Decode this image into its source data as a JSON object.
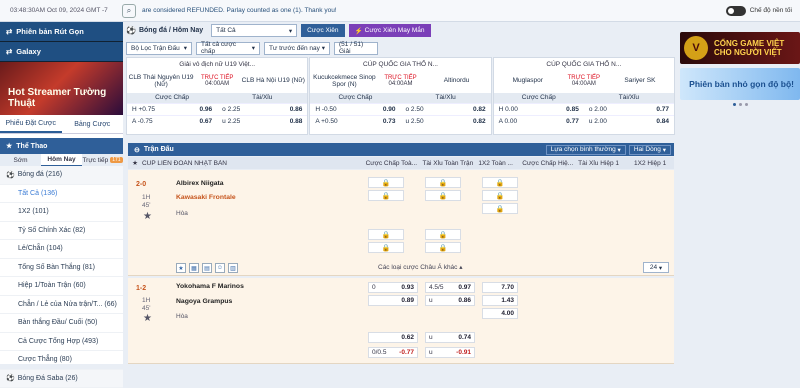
{
  "topbar": {
    "time": "03:48:30AM Oct 09, 2024 GMT -7",
    "notice": "are considered REFUNDED. Parlay counted as one (1). Thank you!",
    "toggle_label": "Chế độ nền tối"
  },
  "sidebar": {
    "promo1": "Phiên bản Rút Gọn",
    "promo2": "Galaxy",
    "banner": "Hot Streamer Tường Thuật",
    "tab_odds": "Phiếu Đặt Cược",
    "tab_table": "Bảng Cược",
    "sport_title": "Thể Thao",
    "subtabs": [
      "Sớm",
      "Hôm Nay",
      "Trực tiếp"
    ],
    "live_badge": "171",
    "items": [
      {
        "label": "Bóng đá",
        "count": "(216)"
      },
      {
        "label": "Tất Cả",
        "count": "(136)"
      },
      {
        "label": "1X2",
        "count": "(101)"
      },
      {
        "label": "Tỷ Số Chính Xác",
        "count": "(82)"
      },
      {
        "label": "Lẻ/Chẵn",
        "count": "(104)"
      },
      {
        "label": "Tổng Số Bàn Thắng",
        "count": "(81)"
      },
      {
        "label": "Hiệp 1/Toàn Trận",
        "count": "(60)"
      },
      {
        "label": "Chẵn / Lẻ của Nửa trận/T...",
        "count": "(66)"
      },
      {
        "label": "Bàn thắng Đầu/ Cuối",
        "count": "(50)"
      },
      {
        "label": "Cả Cược Tổng Hợp",
        "count": "(493)"
      },
      {
        "label": "Cược Thẳng",
        "count": "(80)"
      },
      {
        "label": "Bóng Đá Saba",
        "count": "(26)"
      }
    ]
  },
  "toolbar": {
    "breadcrumb": "Bóng đá / Hôm Nay",
    "filter_all": "Tất Cả",
    "btn_parlay": "Cược Xiên",
    "btn_lucky": "Cược Xiên May Mắn",
    "filter_league": "Bộ Lọc Trận Đấu",
    "filter_markets": "Tất cả cược chấp",
    "sort": "Tư trước đến nay",
    "count": "(51 / 51) Giải"
  },
  "cards": [
    {
      "league": "Giải vô địch nữ U19 Việt...",
      "home": "CLB Thái Nguyên U19 (Nữ)",
      "away": "CLB Hà Nội U19 (Nữ)",
      "live": "TRỰC TIẾP",
      "time": "04:00AM",
      "m1": "Cược Chấp",
      "m2": "Tài/Xỉu",
      "rows": [
        [
          "H +0.75",
          "0.96",
          "o 2.25",
          "0.86"
        ],
        [
          "A -0.75",
          "0.67",
          "u 2.25",
          "0.88"
        ]
      ]
    },
    {
      "league": "CÚP QUỐC GIA THỔ N...",
      "home": "Kucukcekmece Sinop Spor (N)",
      "away": "Altinordu",
      "live": "TRỰC TIẾP",
      "time": "04:00AM",
      "m1": "Cược Chấp",
      "m2": "Tài/Xỉu",
      "rows": [
        [
          "H -0.50",
          "0.90",
          "o 2.50",
          "0.82"
        ],
        [
          "A +0.50",
          "0.73",
          "u 2.50",
          "0.82"
        ]
      ]
    },
    {
      "league": "CÚP QUỐC GIA THỔ N...",
      "home": "Muglaspor",
      "away": "Sariyer SK",
      "live": "TRỰC TIẾP",
      "time": "04:00AM",
      "m1": "Cược Chấp",
      "m2": "Tài/Xỉu",
      "rows": [
        [
          "H 0.00",
          "0.85",
          "o 2.00",
          "0.77"
        ],
        [
          "A 0.00",
          "0.77",
          "u 2.00",
          "0.84"
        ]
      ]
    }
  ],
  "table": {
    "title": "Trận Đấu",
    "sort_label": "Lựa chọn bình thường",
    "odds_type": "Hai Dòng",
    "league": "CÚP LIÊN ĐOÀN NHẬT BẢN",
    "cols": [
      "Cược Chấp Toà...",
      "Tài Xỉu Toàn Trận",
      "1X2 Toàn ...",
      "Cược Chấp Hiệ...",
      "Tài Xỉu Hiệp 1",
      "1X2 Hiệp 1"
    ],
    "more_types": "Các loại cược Châu Á khác",
    "count": "24",
    "matches": [
      {
        "score": "2-0",
        "half": "1H",
        "minute": "45'",
        "home": "Albirex Niigata",
        "away": "Kawasaki Frontale",
        "draw": "Hòa"
      },
      {
        "score": "1-2",
        "half": "1H",
        "minute": "45'",
        "home": "Yokohama F Marinos",
        "away": "Nagoya Grampus",
        "draw": "Hòa",
        "odds": {
          "hdp_line": "0",
          "hdp_home": "0.93",
          "hdp_away": "0.89",
          "ou_line": "4.5/5",
          "ou_over": "0.97",
          "ou_under": "0.86",
          "ou_under_label": "u",
          "x12_home": "7.70",
          "x12_away": "1.43",
          "x12_draw": "4.00",
          "r2_hdp_away": "0.62",
          "r2_ou_label": "u",
          "r2_ou": "0.74",
          "r3_line": "0/0.5",
          "r3_hdp": "-0.77",
          "r3_ou_label": "u",
          "r3_ou": "-0.91"
        }
      }
    ]
  },
  "ads": {
    "ad1": "CỔNG GAME VIỆT CHO NGƯỜI VIỆT",
    "ad1_logo": "V",
    "ad2": "Phiên bản nhỏ gọn độ bộ!"
  },
  "colors": {
    "primary": "#2f5f99",
    "live": "#dd1122",
    "score": "#c6541c",
    "negative": "#c0201f"
  }
}
